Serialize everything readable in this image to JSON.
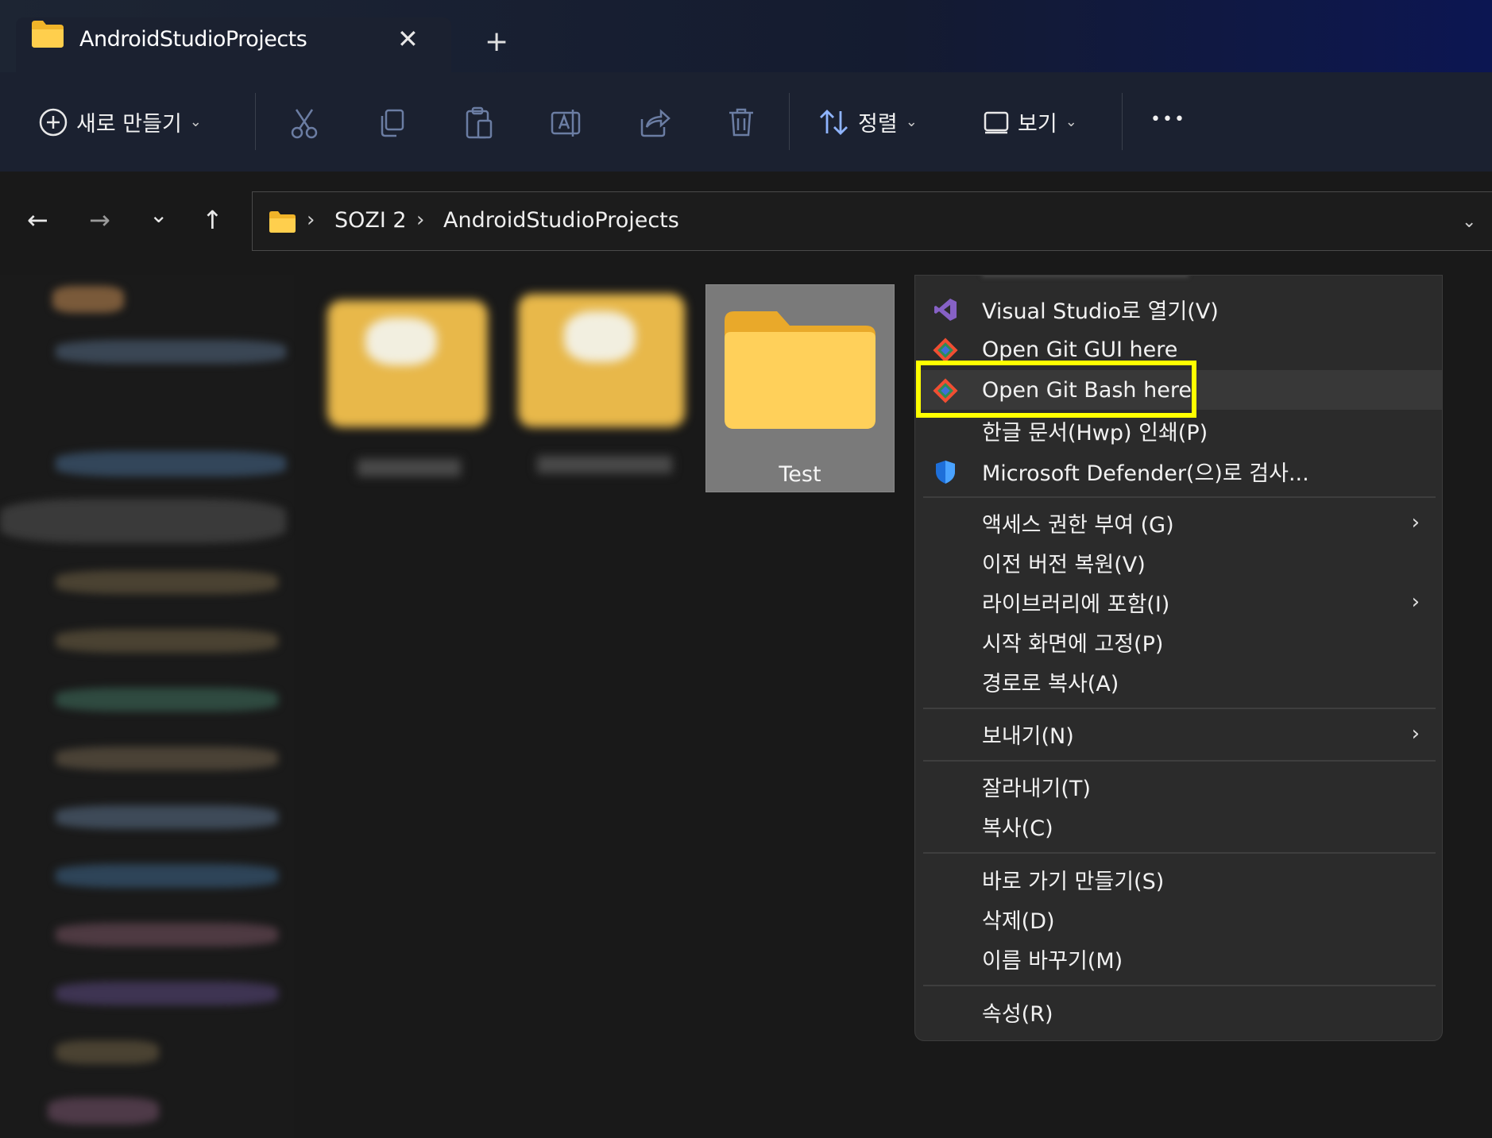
{
  "window": {
    "tab_title": "AndroidStudioProjects",
    "close_glyph": "✕",
    "new_tab_glyph": "+"
  },
  "toolbar": {
    "new_label": "새로 만들기",
    "sort_label": "정렬",
    "view_label": "보기",
    "more_glyph": "•••",
    "chevron": "⌄"
  },
  "nav": {
    "back": "←",
    "forward": "→",
    "recent": "⌄",
    "up": "↑"
  },
  "address": {
    "sep1": "›",
    "crumb1": "SOZI 2",
    "sep2": "›",
    "crumb2": "AndroidStudioProjects",
    "dropdown": "⌄"
  },
  "content": {
    "selected_folder_label": "Test"
  },
  "context_menu": {
    "items": [
      {
        "label": "Visual Studio로 열기(V)",
        "icon": "visual-studio-icon"
      },
      {
        "label": "Open Git GUI here",
        "icon": "git-icon"
      },
      {
        "label": "Open Git Bash here",
        "icon": "git-icon"
      },
      {
        "label": "한글 문서(Hwp) 인쇄(P)",
        "icon": ""
      },
      {
        "label": "Microsoft Defender(으)로 검사...",
        "icon": "defender-shield-icon"
      },
      {
        "label": "액세스 권한 부여 (G)",
        "submenu": "›"
      },
      {
        "label": "이전 버전 복원(V)"
      },
      {
        "label": "라이브러리에 포함(I)",
        "submenu": "›"
      },
      {
        "label": "시작 화면에 고정(P)"
      },
      {
        "label": "경로로 복사(A)"
      },
      {
        "label": "보내기(N)",
        "submenu": "›"
      },
      {
        "label": "잘라내기(T)"
      },
      {
        "label": "복사(C)"
      },
      {
        "label": "바로 가기 만들기(S)"
      },
      {
        "label": "삭제(D)"
      },
      {
        "label": "이름 바꾸기(M)"
      },
      {
        "label": "속성(R)"
      }
    ],
    "highlight_color": "#ffff00"
  },
  "colors": {
    "folder": "#f5c542",
    "accent_blue": "#1e6fd9",
    "git": "#f14e32",
    "visual_studio": "#8661c5"
  }
}
